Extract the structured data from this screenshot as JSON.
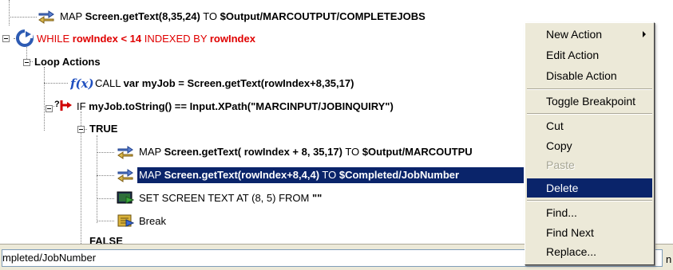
{
  "tree": {
    "rows": [
      {
        "parts": [
          [
            "MAP ",
            ""
          ],
          [
            "Screen.getText(8,35,24)",
            "kw"
          ],
          [
            " TO ",
            ""
          ],
          [
            "$Output/MARCOUTPUT/COMPLETEJOBS",
            "kw"
          ]
        ]
      },
      {
        "parts": [
          [
            "WHILE ",
            ""
          ],
          [
            "rowIndex < 14",
            "kw"
          ],
          [
            " INDEXED BY ",
            ""
          ],
          [
            "rowIndex",
            "kw"
          ]
        ]
      },
      {
        "parts": [
          [
            "Loop Actions",
            "kw"
          ]
        ]
      },
      {
        "parts": [
          [
            "CALL ",
            ""
          ],
          [
            "var myJob = Screen.getText(rowIndex+8,35,17)",
            "kw"
          ]
        ]
      },
      {
        "parts": [
          [
            "IF ",
            ""
          ],
          [
            "myJob.toString() == Input.XPath(\"MARCINPUT/JOBINQUIRY\")",
            "kw"
          ]
        ]
      },
      {
        "parts": [
          [
            "TRUE",
            "kw"
          ]
        ]
      },
      {
        "parts": [
          [
            "MAP ",
            ""
          ],
          [
            "Screen.getText( rowIndex + 8, 35,17)",
            "kw"
          ],
          [
            " TO ",
            ""
          ],
          [
            "$Output/MARCOUTPU",
            "kw"
          ]
        ]
      },
      {
        "parts": [
          [
            "MAP ",
            ""
          ],
          [
            "Screen.getText(rowIndex+8,4,4)",
            "kw"
          ],
          [
            " TO ",
            ""
          ],
          [
            "$Completed/JobNumber",
            "kw"
          ]
        ]
      },
      {
        "parts": [
          [
            "SET SCREEN TEXT AT (8, 5) FROM ",
            ""
          ],
          [
            "\"\"",
            "kw"
          ]
        ]
      },
      {
        "parts": [
          [
            "Break",
            ""
          ]
        ]
      },
      {
        "parts": [
          [
            "FALSE",
            "kw"
          ]
        ]
      }
    ]
  },
  "status": {
    "text": "mpleted/JobNumber",
    "right_char": "n"
  },
  "context_menu": {
    "items": [
      {
        "label": "New Action",
        "submenu": true
      },
      {
        "label": "Edit Action"
      },
      {
        "label": "Disable Action"
      },
      {
        "label": "Toggle Breakpoint"
      },
      {
        "label": "Cut"
      },
      {
        "label": "Copy"
      },
      {
        "label": "Paste",
        "disabled": true
      },
      {
        "label": "Delete",
        "active": true
      },
      {
        "label": "Find..."
      },
      {
        "label": "Find Next"
      },
      {
        "label": "Replace..."
      }
    ]
  },
  "icons": {
    "map": "map-arrows-icon",
    "while": "loop-arrow-icon",
    "call": "function-icon",
    "if": "if-branch-icon",
    "set_screen": "screen-text-icon",
    "break": "break-icon"
  },
  "colors": {
    "selection": "#0a246a",
    "while_text": "#e00000",
    "menu_bg": "#ece9d8"
  }
}
